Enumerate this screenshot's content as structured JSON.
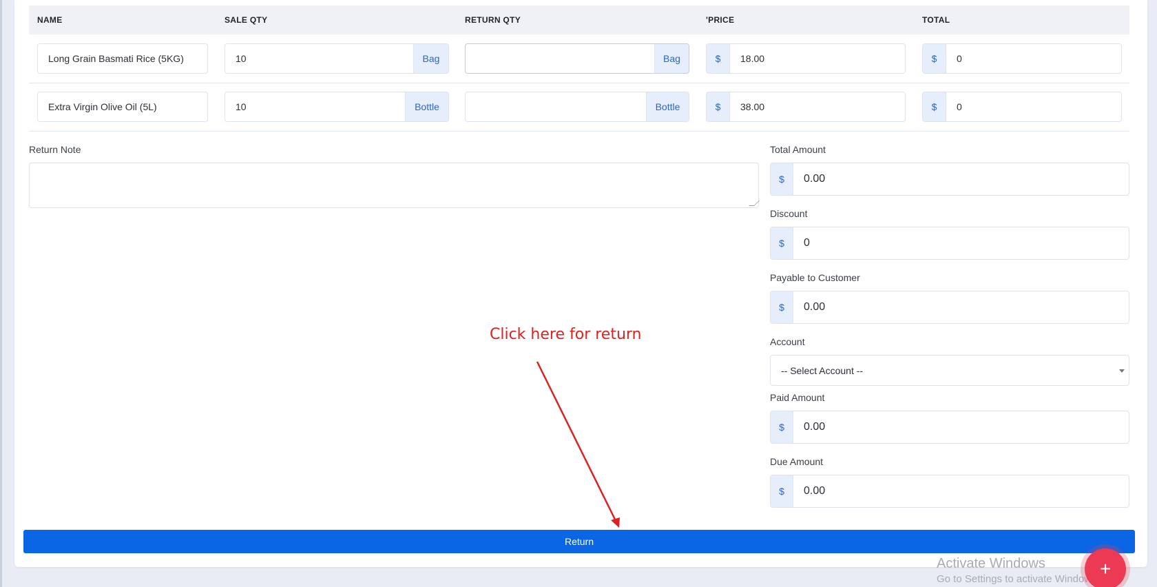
{
  "table": {
    "headers": [
      "NAME",
      "SALE QTY",
      "RETURN QTY",
      "'PRICE",
      "TOTAL"
    ],
    "rows": [
      {
        "name": "Long Grain Basmati Rice (5KG)",
        "sale_qty": "10",
        "sale_unit": "Bag",
        "return_qty": "",
        "return_unit": "Bag",
        "currency": "$",
        "price": "18.00",
        "total": "0"
      },
      {
        "name": "Extra Virgin Olive Oil (5L)",
        "sale_qty": "10",
        "sale_unit": "Bottle",
        "return_qty": "",
        "return_unit": "Bottle",
        "currency": "$",
        "price": "38.00",
        "total": "0"
      }
    ]
  },
  "form": {
    "return_note_label": "Return Note",
    "currency": "$",
    "total_amount_label": "Total Amount",
    "total_amount": "0.00",
    "discount_label": "Discount",
    "discount": "0",
    "payable_label": "Payable to Customer",
    "payable": "0.00",
    "account_label": "Account",
    "account_selected": "-- Select Account --",
    "paid_amount_label": "Paid Amount",
    "paid_amount": "0.00",
    "due_amount_label": "Due Amount",
    "due_amount": "0.00"
  },
  "return_button": "Return",
  "annotation": "Click here for return",
  "annotation_color": "#e02020",
  "accent_color": "#0a66e4",
  "fab": {
    "icon": "plus-icon",
    "glyph": "+",
    "color": "#ec3a55"
  },
  "watermark": {
    "title": "Activate Windows",
    "subtitle": "Go to Settings to activate Windows."
  }
}
